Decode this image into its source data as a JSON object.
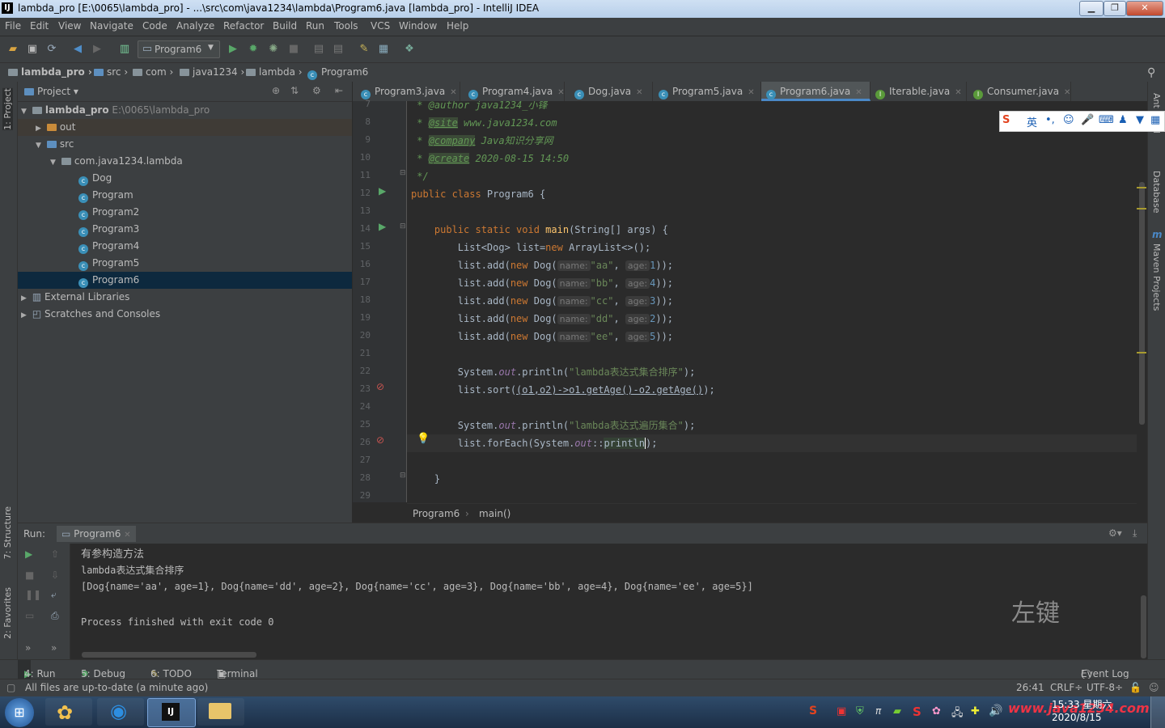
{
  "window": {
    "title": "lambda_pro [E:\\0065\\lambda_pro] - ...\\src\\com\\java1234\\lambda\\Program6.java [lambda_pro] - IntelliJ IDEA",
    "logo": "IJ"
  },
  "menu": [
    "File",
    "Edit",
    "View",
    "Navigate",
    "Code",
    "Analyze",
    "Refactor",
    "Build",
    "Run",
    "Tools",
    "VCS",
    "Window",
    "Help"
  ],
  "toolbar": {
    "run_config": "Program6"
  },
  "breadcrumbs": [
    "lambda_pro",
    "src",
    "com",
    "java1234",
    "lambda",
    "Program6"
  ],
  "left_strip": {
    "project": "1: Project",
    "structure": "7: Structure",
    "favorites": "2: Favorites"
  },
  "right_strip": {
    "ant": "Ant Build",
    "database": "Database",
    "maven": "Maven Projects",
    "maven_icon": "m"
  },
  "project_panel": {
    "title": "Project",
    "tree": [
      {
        "label": "lambda_pro",
        "path": "E:\\0065\\lambda_pro"
      },
      {
        "label": "out"
      },
      {
        "label": "src"
      },
      {
        "label": "com.java1234.lambda"
      },
      {
        "label": "Dog"
      },
      {
        "label": "Program"
      },
      {
        "label": "Program2"
      },
      {
        "label": "Program3"
      },
      {
        "label": "Program4"
      },
      {
        "label": "Program5"
      },
      {
        "label": "Program6"
      },
      {
        "label": "External Libraries"
      },
      {
        "label": "Scratches and Consoles"
      }
    ]
  },
  "editor_tabs": [
    "Program3.java",
    "Program4.java",
    "Dog.java",
    "Program5.java",
    "Program6.java",
    "Iterable.java",
    "Consumer.java"
  ],
  "editor": {
    "line_numbers": [
      "7",
      "8",
      "9",
      "10",
      "11",
      "12",
      "13",
      "14",
      "15",
      "16",
      "17",
      "18",
      "19",
      "20",
      "21",
      "22",
      "23",
      "24",
      "25",
      "26",
      "27",
      "28",
      "29"
    ],
    "author_line": " * @author java1234_小锋",
    "site_tag": "@site",
    "site_val": " www.java1234.com",
    "company_tag": "@company",
    "company_val": " Java知识分享网",
    "create_tag": "@create",
    "create_val": " 2020-08-15 14:50",
    "close_comment": " */",
    "class_decl_kw": "public class",
    "class_name": " Program6 {",
    "main_kw": "public static void",
    "main_name": " main",
    "main_args": "(String[] args) {",
    "list_decl_a": "List<Dog> list=",
    "list_decl_kw": "new",
    "list_decl_b": " ArrayList<>();",
    "add_prefix": "list.add(",
    "new_kw": "new",
    "dog_ctor": " Dog(",
    "hint_name": "name:",
    "hint_age": "age:",
    "dogs": [
      {
        "name": "\"aa\"",
        "age": "1"
      },
      {
        "name": "\"bb\"",
        "age": "4"
      },
      {
        "name": "\"cc\"",
        "age": "3"
      },
      {
        "name": "\"dd\"",
        "age": "2"
      },
      {
        "name": "\"ee\"",
        "age": "5"
      }
    ],
    "add_suffix": "));",
    "println_prefix": "System.",
    "out_field": "out",
    "println_call": ".println(",
    "println1_str": "\"lambda表达式集合排序\"",
    "stmt_end": ");",
    "sort_prefix": "list.sort(",
    "sort_lambda": "(o1,o2)->o1.getAge()-o2.getAge()",
    "sort_end": ");",
    "println2_str": "\"lambda表达式遍历集合\"",
    "foreach_prefix": "list.forEach(System.",
    "foreach_out": "out",
    "foreach_ref": "::",
    "foreach_fn": "println",
    "foreach_end": ");",
    "close_brace_inner": "}",
    "breadcrumb_class": "Program6",
    "breadcrumb_method": "main()"
  },
  "run_panel": {
    "label": "Run:",
    "tab": "Program6",
    "output": [
      "有参构造方法",
      "lambda表达式集合排序",
      "[Dog{name='aa', age=1}, Dog{name='dd', age=2}, Dog{name='cc', age=3}, Dog{name='bb', age=4}, Dog{name='ee', age=5}]",
      "",
      "Process finished with exit code 0"
    ],
    "overlay_text": "左键"
  },
  "bottom_tabs": [
    "4: Run",
    "5: Debug",
    "6: TODO",
    "Terminal"
  ],
  "event_log": "Event Log",
  "status": {
    "message": "All files are up-to-date (a minute ago)",
    "position": "26:41",
    "line_sep": "CRLF÷",
    "encoding": "UTF-8÷"
  },
  "ime": {
    "lang": "英"
  },
  "taskbar": {
    "time": "15:33 星期六",
    "date": "2020/8/15",
    "watermark": "www.java1234.com"
  },
  "colors": {
    "bg": "#2b2b2b",
    "panel": "#3c3f41",
    "keyword": "#cc7832",
    "string": "#6a8759",
    "selection": "#0d293e"
  }
}
